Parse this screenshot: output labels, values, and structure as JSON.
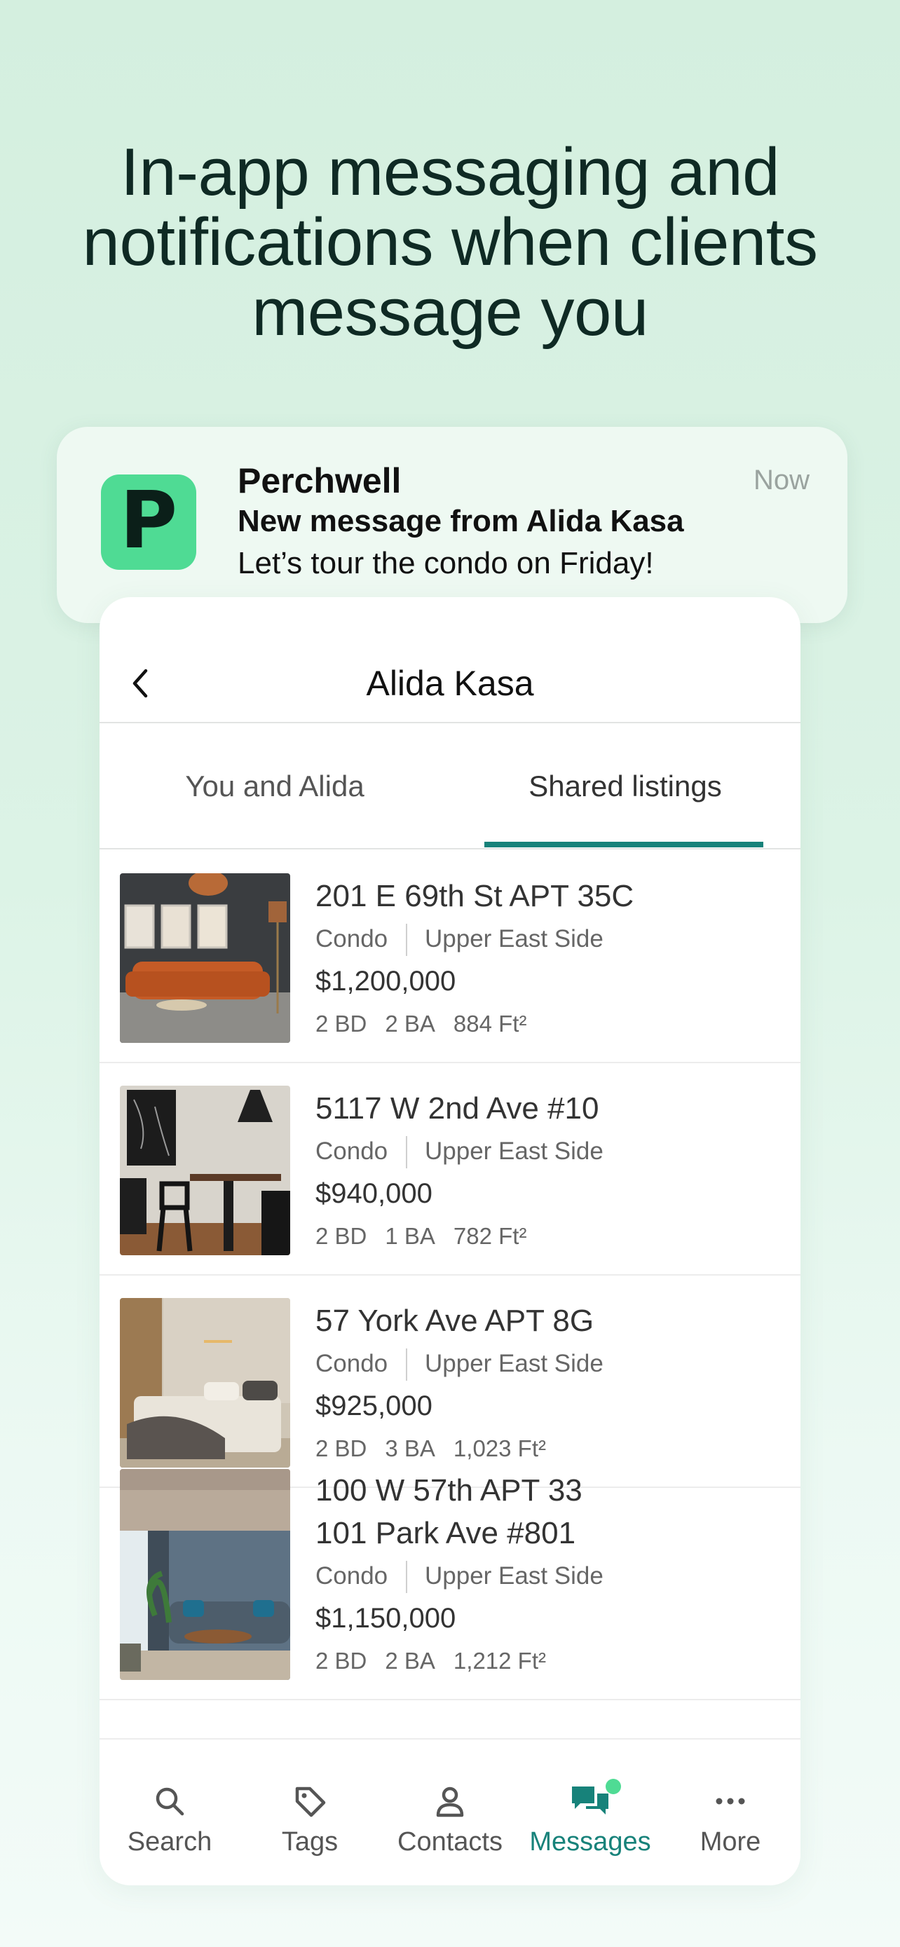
{
  "headline": {
    "line1": "In-app messaging and",
    "line2": "notifications when clients",
    "line3": "message you"
  },
  "notification": {
    "logo_letter": "P",
    "app_name": "Perchwell",
    "time": "Now",
    "title": "New message from Alida Kasa",
    "body": "Let’s tour the condo on Friday!"
  },
  "chat": {
    "title": "Alida Kasa",
    "tabs": [
      {
        "label": "You and Alida",
        "active": false
      },
      {
        "label": "Shared listings",
        "active": true
      }
    ]
  },
  "listings": [
    {
      "address": "201 E 69th St APT 35C",
      "type": "Condo",
      "neighborhood": "Upper East Side",
      "price": "$1,200,000",
      "beds": "2 BD",
      "baths": "2 BA",
      "area": "884 Ft²"
    },
    {
      "address": "5117 W 2nd Ave #10",
      "type": "Condo",
      "neighborhood": "Upper East Side",
      "price": "$940,000",
      "beds": "2 BD",
      "baths": "1 BA",
      "area": "782 Ft²"
    },
    {
      "address": "57 York Ave APT 8G",
      "type": "Condo",
      "neighborhood": "Upper East Side",
      "price": "$925,000",
      "beds": "2 BD",
      "baths": "3 BA",
      "area": "1,023 Ft²"
    },
    {
      "address": "101 Park Ave #801",
      "type": "Condo",
      "neighborhood": "Upper East Side",
      "price": "$1,150,000",
      "beds": "2 BD",
      "baths": "2 BA",
      "area": "1,212 Ft²"
    },
    {
      "address": "100 W 57th APT 33"
    }
  ],
  "nav": [
    {
      "label": "Search",
      "icon": "search-icon",
      "active": false
    },
    {
      "label": "Tags",
      "icon": "tag-icon",
      "active": false
    },
    {
      "label": "Contacts",
      "icon": "person-icon",
      "active": false
    },
    {
      "label": "Messages",
      "icon": "chat-icon",
      "active": true
    },
    {
      "label": "More",
      "icon": "more-dots-icon",
      "active": false
    }
  ],
  "colors": {
    "accent": "#17827a",
    "brand_green": "#4fdb94",
    "headline": "#0f2a24"
  }
}
